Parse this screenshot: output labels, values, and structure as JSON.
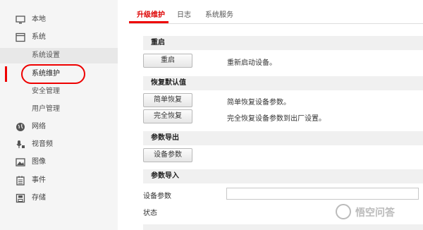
{
  "sidebar": {
    "items": [
      {
        "label": "本地",
        "icon": "monitor-icon"
      },
      {
        "label": "系统",
        "icon": "window-icon"
      },
      {
        "label": "系统设置"
      },
      {
        "label": "系统维护"
      },
      {
        "label": "安全管理"
      },
      {
        "label": "用户管理"
      },
      {
        "label": "网络",
        "icon": "globe-icon"
      },
      {
        "label": "视音频",
        "icon": "audio-video-icon"
      },
      {
        "label": "图像",
        "icon": "image-icon"
      },
      {
        "label": "事件",
        "icon": "calendar-icon"
      },
      {
        "label": "存储",
        "icon": "storage-icon"
      }
    ]
  },
  "tabs": [
    "升级维护",
    "日志",
    "系统服务"
  ],
  "sections": {
    "restart": {
      "title": "重启",
      "button": "重启",
      "desc": "重新启动设备。"
    },
    "restore": {
      "title": "恢复默认值",
      "simple_button": "简单恢复",
      "simple_desc": "简单恢复设备参数。",
      "full_button": "完全恢复",
      "full_desc": "完全恢复设备参数到出厂设置。"
    },
    "export": {
      "title": "参数导出",
      "button": "设备参数"
    },
    "import": {
      "title": "参数导入",
      "field_label": "设备参数",
      "field_value": "",
      "status_label": "状态"
    }
  },
  "watermark": {
    "text": "悟空问答"
  },
  "colors": {
    "accent": "#e00000",
    "sidebar_bg": "#f5f5f5",
    "section_bg": "#f0f0f0"
  }
}
